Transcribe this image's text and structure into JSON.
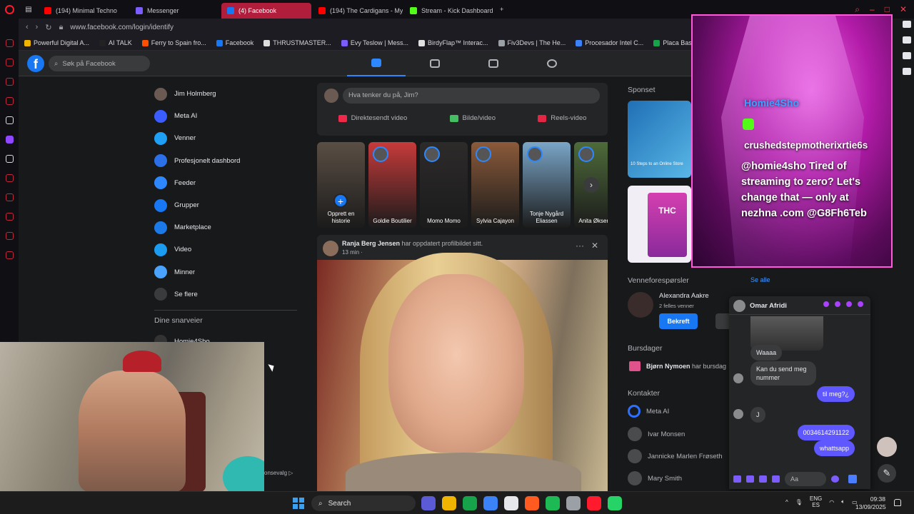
{
  "browser": {
    "tabs": [
      {
        "label": "(194) Minimal Techno",
        "color": "#ff0000"
      },
      {
        "label": "Messenger",
        "color": "#7b5cff"
      },
      {
        "label": "(4) Facebook",
        "color": "#1877f2",
        "active": true
      },
      {
        "label": "(194) The Cardigans - My",
        "color": "#ff0000"
      },
      {
        "label": "Stream - Kick Dashboard",
        "color": "#53fc18"
      }
    ],
    "new_tab": "+",
    "url": "www.facebook.com/login/identify",
    "bookmarks": [
      "Powerful Digital A...",
      "AI TALK",
      "Ferry to Spain fro...",
      "Facebook",
      "THRUSTMASTER...",
      "Evy Teslow | Mess...",
      "BirdyFlap™ Interac...",
      "Fiv3Devs | The He...",
      "Procesador Intel C...",
      "Placa Base Gigaby..."
    ]
  },
  "facebook": {
    "logo": "f",
    "search_placeholder": "Søk på Facebook",
    "left_menu": [
      {
        "label": "Jim Holmberg",
        "color": "#6b5a52"
      },
      {
        "label": "Meta AI",
        "color": "#3b5cff"
      },
      {
        "label": "Venner",
        "color": "#1ea0f5"
      },
      {
        "label": "Profesjonelt dashbord",
        "color": "#2b70e8"
      },
      {
        "label": "Feeder",
        "color": "#2d88ff"
      },
      {
        "label": "Grupper",
        "color": "#1877f2"
      },
      {
        "label": "Marketplace",
        "color": "#1b7ae8"
      },
      {
        "label": "Video",
        "color": "#1c9cf0"
      },
      {
        "label": "Minner",
        "color": "#4aa3ff"
      },
      {
        "label": "Se flere",
        "color": "#3a3b3c"
      }
    ],
    "shortcuts_heading": "Dine snarveier",
    "shortcut": "Homie4Sho",
    "composer_placeholder": "Hva tenker du på, Jim?",
    "composer_actions": [
      {
        "label": "Direktesendt video",
        "color": "#f02849"
      },
      {
        "label": "Bilde/video",
        "color": "#45bd62"
      },
      {
        "label": "Reels-video",
        "color": "#e42645"
      }
    ],
    "stories": [
      {
        "label": "Opprett en historie",
        "bg": "#5a4e44"
      },
      {
        "label": "Goldie Boutilier",
        "bg": "#c73a3a"
      },
      {
        "label": "Momo Momo",
        "bg": "#2d2a2a"
      },
      {
        "label": "Sylvia Cajayon",
        "bg": "#8b5a3a"
      },
      {
        "label": "Tonje Nygård Eliassen",
        "bg": "#7aa6c8"
      },
      {
        "label": "Anita Øksendal",
        "bg": "#4e6b3a"
      }
    ],
    "stories_next": "›",
    "post": {
      "author": "Ranja Berg Jensen",
      "action": "har oppdatert profilbildet sitt.",
      "time": "13 min ·",
      "menu": "···",
      "close": "✕"
    },
    "sponsored_heading": "Sponset",
    "ad1_text": "10 Steps to an Online Store",
    "ad2_text": "THC",
    "friend_requests_heading": "Venneforespørsler",
    "see_all": "Se alle",
    "friend_request": {
      "name": "Alexandra Aakre",
      "mutual": "2 felles venner",
      "confirm": "Bekreft"
    },
    "birthdays_heading": "Bursdager",
    "birthday": {
      "name": "Bjørn Nymoen",
      "text": "har bursdag"
    },
    "contacts_heading": "Kontakter",
    "contacts": [
      "Meta AI",
      "Ivar Monsen",
      "Jannicke Marlen Frøseth",
      "Mary Smith"
    ]
  },
  "overlay": {
    "username": "Homie4Sho",
    "chatter": "crushedstepmotherixrtie6s",
    "message": "@homie4sho Tired of streaming to zero? Let's change that — only at nezhna .com @G8Fh6Teb"
  },
  "chat": {
    "name": "Omar Afridi",
    "messages": [
      {
        "text": "Waaaa",
        "dir": "in"
      },
      {
        "text": "Kan du send meg nummer",
        "dir": "in"
      },
      {
        "text": "til meg?¿",
        "dir": "out"
      },
      {
        "text": "J",
        "dir": "in"
      },
      {
        "text": "0034614291122",
        "dir": "out"
      },
      {
        "text": "whattsapp",
        "dir": "out"
      }
    ],
    "input_placeholder": "Aa",
    "compose_icon": "✎"
  },
  "webcam": {
    "privacy_fragment": "onsevalg ▷"
  },
  "taskbar": {
    "search_label": "Search",
    "apps": [
      "#5b5bd6",
      "#f0b400",
      "#16a34a",
      "#3b82f6",
      "#e5e7eb",
      "#ff5a1f",
      "#1db954",
      "#9aa0a6",
      "#ff1b2d",
      "#25d366"
    ],
    "lang": "ENG",
    "region": "ES",
    "time": "09:38",
    "date": "13/09/2025"
  }
}
